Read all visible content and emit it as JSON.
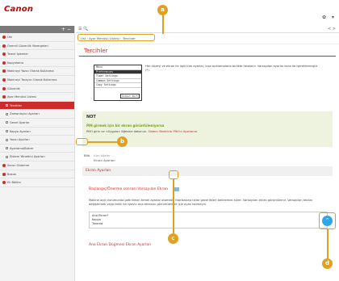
{
  "brand": {
    "logo_text": "Canon"
  },
  "top_icons": {
    "settings": "✿",
    "menu": "▾"
  },
  "sidebar": {
    "tool_label": "+ −",
    "items": [
      {
        "label": "Üst",
        "type": "dot"
      },
      {
        "label": "Önemli Güvenlik Yönergeleri",
        "type": "dot"
      },
      {
        "label": "Temel İşlemler",
        "type": "dot"
      },
      {
        "label": "Kopyalama",
        "type": "dot"
      },
      {
        "label": "Makineyi Yazıcı Olarak Kullanma",
        "type": "dot"
      },
      {
        "label": "Makineyi Tarayıcı Olarak Kullanma",
        "type": "dot"
      },
      {
        "label": "Güvenlik",
        "type": "dot"
      },
      {
        "label": "Ayar Menüsü Listesi",
        "type": "dot"
      },
      {
        "label": "Tercihler",
        "type": "active"
      },
      {
        "label": "Zamanlayıcı Ayarları",
        "type": "sub"
      },
      {
        "label": "Genel Ayarlar",
        "type": "sub"
      },
      {
        "label": "Kopya Ayarları",
        "type": "sub"
      },
      {
        "label": "Yazıcı Ayarları",
        "type": "sub"
      },
      {
        "label": "Ayarlama/Bakım",
        "type": "sub"
      },
      {
        "label": "Sistem Yönetimi Ayarları",
        "type": "sub"
      },
      {
        "label": "Sorun Giderme",
        "type": "dot"
      },
      {
        "label": "Bakım",
        "type": "dot"
      },
      {
        "label": "Ek Bölüm",
        "type": "dot"
      }
    ]
  },
  "main": {
    "tools_left": "☰ 🔍",
    "tools_right": "<  >",
    "breadcrumb": "Üst › Ayar Menüsü Listesi › Tercihler",
    "title": "Tercihler",
    "screen_rows": [
      "Menu",
      "Preferences",
      "Timer Settings",
      "Common Settings",
      "Copy Settings"
    ],
    "screen_back": "Output Rprt",
    "intro_text": "Her düzeyi ve ekran ile ilgili tüm ayarlar, kısa açıklamalarla birlikte listelenir. Varsayılan ayarlar kalın ile işaretlenmiştir (*).",
    "note_title": "NOT",
    "note_head": "PIN girmek için bir ekran görüntüleniyorsa",
    "note_body_prefix": "PIN'i girin ve <Uygula> öğesine dokunun.",
    "note_link": "Sistem Yöneticisi PIN'ini Ayarlama",
    "tag_label": "Etik",
    "tag_text": "tüm öğeler",
    "tag_sub": "Ekran Ayarları",
    "section_head": "Ekran Ayarları",
    "sub_head": "Başlangıç/Önerme sonrası Varsayılan Ekran",
    "sub_body": "Makine açık durumunda getirilirken temel ayarlar otomatik fabrikasına tıklar geçerlikleri belirlemek sürer. Varsayılan ekran görüntülenir. Varsayılan ekranı değiştirmek veya farklı bir işlevin ana ekranını görüntülemek için ayarı belirleyin.",
    "table_rows": [
      "Ana Ekran*",
      "Kopya",
      "Tarama"
    ],
    "sub_head2": "Ana Ekran Düğmesi Ekran Ayarları",
    "scroll_top_icon": "⌃"
  },
  "callouts": [
    "a",
    "b",
    "c",
    "d"
  ],
  "colors": {
    "brand_red": "#cc2b2b",
    "callout": "#e0a020",
    "scroll_blue": "#2fa7e6"
  }
}
